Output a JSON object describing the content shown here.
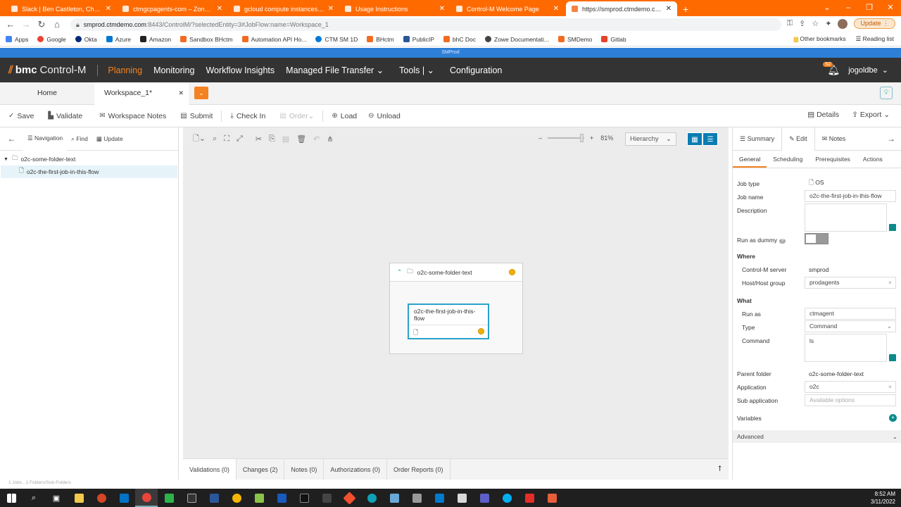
{
  "browser": {
    "tabs": [
      {
        "title": "Slack | Ben Castleton, Checking",
        "active": false
      },
      {
        "title": "ctmgcpagents-com – Zone detail",
        "active": false
      },
      {
        "title": "gcloud compute instances delete",
        "active": false
      },
      {
        "title": "Usage Instructions",
        "active": false
      },
      {
        "title": "Control-M Welcome Page",
        "active": false
      },
      {
        "title": "https://smprod.ctmdemo.com:844",
        "active": true
      }
    ],
    "url_host": "smprod.ctmdemo.com",
    "url_path": ":8443/ControlM/?selectedEntity=3#JobFlow:name=Workspace_1",
    "update_label": "Update",
    "bookmarks": [
      "Apps",
      "Google",
      "Okta",
      "Azure",
      "Amazon",
      "Sandbox BHctm",
      "Automation API Ho...",
      "CTM SM 1D",
      "BHctm",
      "PublicIP",
      "bhC Doc",
      "Zowe Documentati...",
      "SMDemo",
      "Gitlab"
    ],
    "other_bookmarks": "Other bookmarks",
    "reading_list": "Reading list"
  },
  "app": {
    "environment": "SMProd",
    "logo_brand": "bmc",
    "logo_product": "Control-M",
    "nav": [
      "Planning",
      "Monitoring",
      "Workflow Insights",
      "Managed File Transfer ⌄",
      "Tools | ⌄",
      "Configuration"
    ],
    "alert_count": "52",
    "username": "jogoldbe",
    "tabs": {
      "home": "Home",
      "workspace": "Workspace_1*"
    },
    "toolbar": {
      "save": "Save",
      "validate": "Validate",
      "notes": "Workspace Notes",
      "submit": "Submit",
      "checkin": "Check In",
      "order": "Order",
      "load": "Load",
      "unload": "Unload",
      "details": "Details",
      "export": "Export"
    },
    "left": {
      "tabs": {
        "navigation": "Navigation",
        "find": "Find",
        "update": "Update"
      },
      "folder": "o2c-some-folder-text",
      "job": "o2c-the-first-job-in-this-flow"
    },
    "canvas": {
      "zoom": "81%",
      "view": "Hierarchy",
      "folder_title": "o2c-some-folder-text",
      "job_title": "o2c-the-first-job-in-this-flow"
    },
    "bottom_tabs": [
      "Validations (0)",
      "Changes (2)",
      "Notes (0)",
      "Authorizations (0)",
      "Order Reports (0)"
    ],
    "status": "1 Jobs , 1 Folders/Sub-Folders",
    "right": {
      "tabs": {
        "summary": "Summary",
        "edit": "Edit",
        "notes": "Notes"
      },
      "subtabs": [
        "General",
        "Scheduling",
        "Prerequisites",
        "Actions"
      ],
      "job_type_label": "Job type",
      "job_type": "OS",
      "job_name_label": "Job name",
      "job_name": "o2c-the-first-job-in-this-flow",
      "description_label": "Description",
      "dummy_label": "Run as dummy",
      "where_label": "Where",
      "server_label": "Control-M server",
      "server": "smprod",
      "host_label": "Host/Host group",
      "host": "prodagents",
      "what_label": "What",
      "runas_label": "Run as",
      "runas": "ctmagent",
      "type_label": "Type",
      "type": "Command",
      "command_label": "Command",
      "command": "ls",
      "parent_label": "Parent folder",
      "parent": "o2c-some-folder-text",
      "application_label": "Application",
      "application": "o2c",
      "subapp_label": "Sub application",
      "subapp_placeholder": "Available options",
      "variables_label": "Variables",
      "advanced_label": "Advanced"
    }
  },
  "taskbar": {
    "time": "8:52 AM",
    "date": "3/11/2022"
  }
}
